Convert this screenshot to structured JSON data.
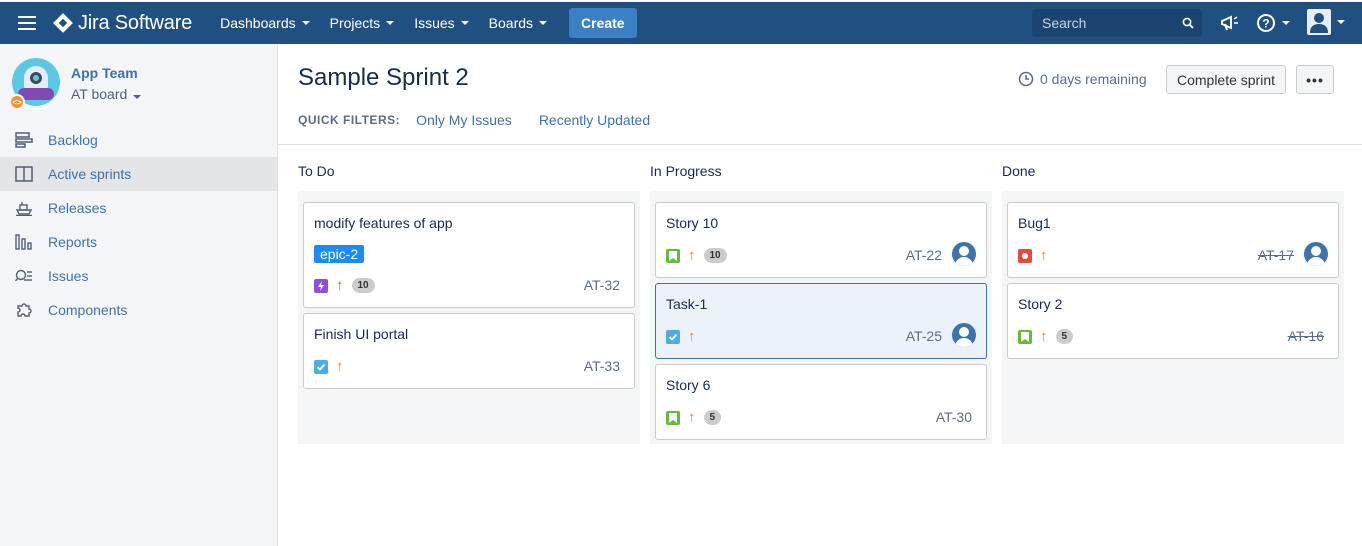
{
  "nav": {
    "logo": "Jira Software",
    "menus": [
      "Dashboards",
      "Projects",
      "Issues",
      "Boards"
    ],
    "create": "Create",
    "search_placeholder": "Search",
    "bar_color": "#205081"
  },
  "sidebar": {
    "project_name": "App Team",
    "board_name": "AT board",
    "items": [
      {
        "label": "Backlog",
        "icon": "backlog-icon"
      },
      {
        "label": "Active sprints",
        "icon": "board-icon",
        "active": true
      },
      {
        "label": "Releases",
        "icon": "ship-icon"
      },
      {
        "label": "Reports",
        "icon": "chart-icon"
      },
      {
        "label": "Issues",
        "icon": "search-list-icon"
      },
      {
        "label": "Components",
        "icon": "puzzle-icon"
      }
    ]
  },
  "sprint": {
    "title": "Sample Sprint 2",
    "remaining": "0 days remaining",
    "complete_button": "Complete sprint",
    "more_button": "•••"
  },
  "quick_filters": {
    "label": "QUICK FILTERS:",
    "filters": [
      "Only My Issues",
      "Recently Updated"
    ]
  },
  "columns": [
    {
      "name": "To Do",
      "cards": [
        {
          "title": "modify features of app",
          "epic": "epic-2",
          "type": "improvement",
          "priority": "major",
          "estimate": "10",
          "key": "AT-32",
          "assignee": false
        },
        {
          "title": "Finish UI portal",
          "type": "task",
          "priority": "major",
          "estimate": "",
          "key": "AT-33",
          "assignee": false
        }
      ]
    },
    {
      "name": "In Progress",
      "cards": [
        {
          "title": "Story 10",
          "type": "story",
          "priority": "major",
          "estimate": "10",
          "key": "AT-22",
          "assignee": true
        },
        {
          "title": "Task-1",
          "type": "task",
          "priority": "major",
          "estimate": "",
          "key": "AT-25",
          "assignee": true,
          "selected": true
        },
        {
          "title": "Story 6",
          "type": "story",
          "priority": "major",
          "estimate": "5",
          "key": "AT-30",
          "assignee": false
        }
      ]
    },
    {
      "name": "Done",
      "cards": [
        {
          "title": "Bug1",
          "type": "bug",
          "priority": "major",
          "estimate": "",
          "key": "AT-17",
          "assignee": true,
          "done": true
        },
        {
          "title": "Story 2",
          "type": "story",
          "priority": "major",
          "estimate": "5",
          "key": "AT-16",
          "assignee": false,
          "done": true
        }
      ]
    }
  ],
  "colors": {
    "link": "#3b73af",
    "story": "#63ba3c",
    "task": "#4bade8",
    "bug": "#e5493a",
    "improvement": "#904ee2",
    "priority": "#e97f33",
    "epic": "#1a8cff"
  }
}
